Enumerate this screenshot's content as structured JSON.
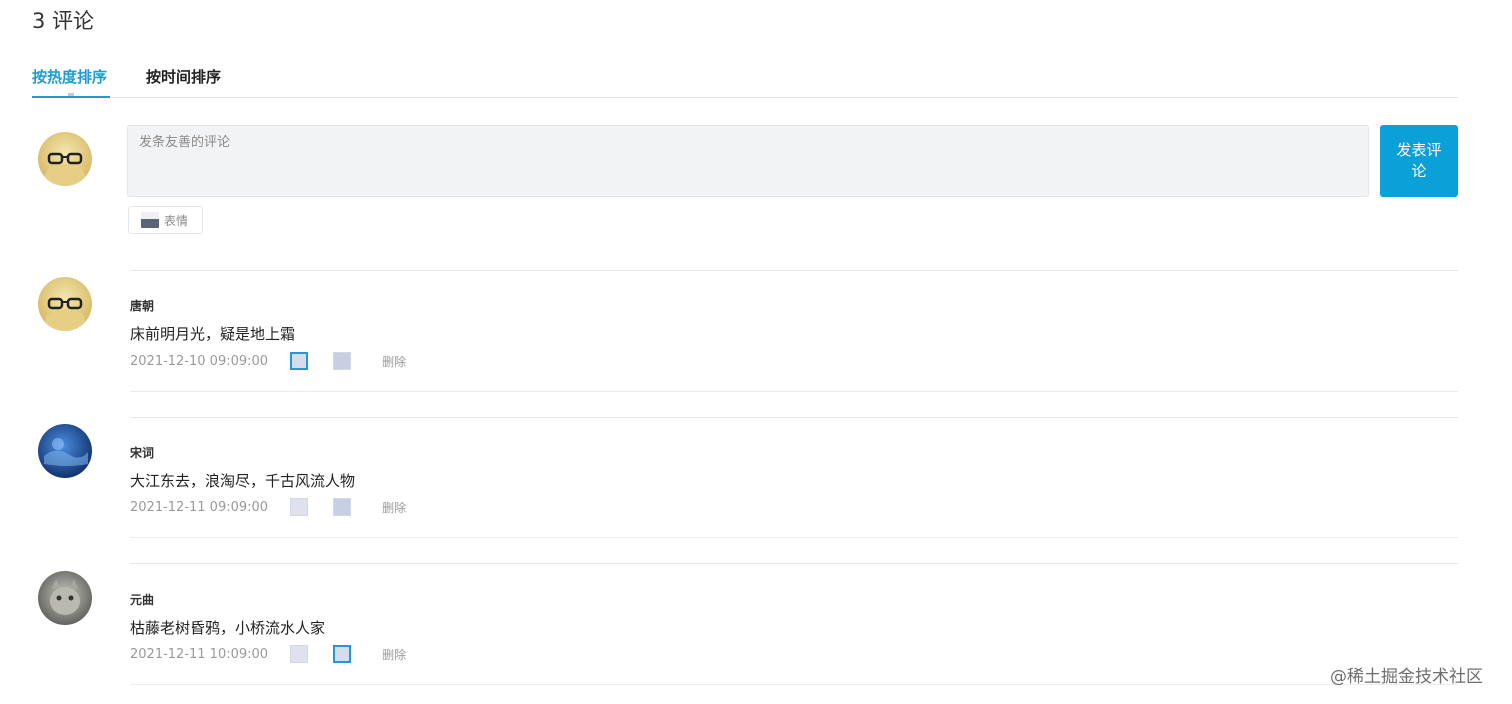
{
  "header": {
    "comment_count_title": "3 评论"
  },
  "tabs": [
    {
      "label": "按热度排序",
      "active": true
    },
    {
      "label": "按时间排序",
      "active": false
    }
  ],
  "composer": {
    "placeholder": "发条友善的评论",
    "value": "",
    "submit_label": "发表评论",
    "emoji_label": "表情"
  },
  "comments": [
    {
      "user": "唐朝",
      "text": "床前明月光，疑是地上霜",
      "time": "2021-12-10 09:09:00",
      "like_active": true,
      "dislike_active": false,
      "delete_label": "删除"
    },
    {
      "user": "宋词",
      "text": "大江东去，浪淘尽，千古风流人物",
      "time": "2021-12-11 09:09:00",
      "like_active": false,
      "dislike_active": false,
      "delete_label": "删除"
    },
    {
      "user": "元曲",
      "text": "枯藤老树昏鸦，小桥流水人家",
      "time": "2021-12-11 10:09:00",
      "like_active": false,
      "dislike_active": true,
      "delete_label": "删除"
    }
  ],
  "watermark": "@稀土掘金技术社区",
  "colors": {
    "accent": "#0ba0d8",
    "tab_active": "#1f9bd2"
  }
}
